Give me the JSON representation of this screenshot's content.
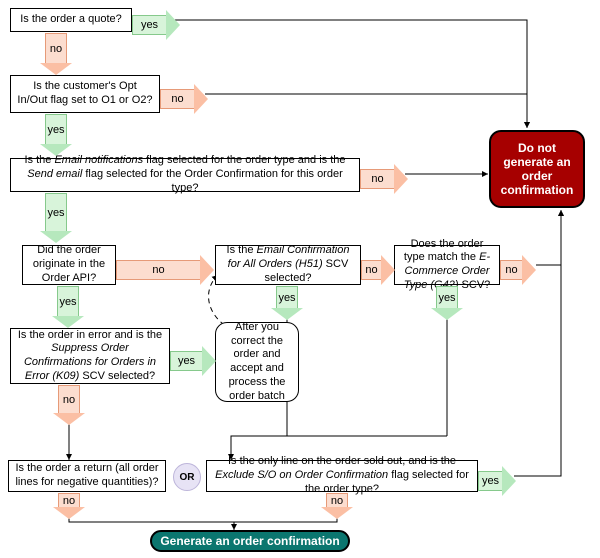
{
  "labels": {
    "yes": "yes",
    "no": "no",
    "or": "OR"
  },
  "nodes": {
    "q_quote": "Is the order a quote?",
    "q_optin": "Is the customer's Opt In/Out flag set to O1 or O2?",
    "q_emailflags_html": "Is the <em>Email notifications</em> flag selected for the order type and is the <em>Send email</em> flag selected for the Order Confirmation for this order type?",
    "q_api": "Did the order originate in the Order API?",
    "q_h51_html": "Is the <em>Email Confirmation for All Orders (H51)</em> SCV selected?",
    "q_g42_html": "Does the order type match the <em>E-Commerce Order Type (G42)</em> SCV?",
    "q_suppress_html": "Is the order in error and is the <em>Suppress Order Confirmations for Orders in Error (K09)</em> SCV selected?",
    "n_afterfix": "After you correct the order and accept and process the order batch",
    "q_return": "Is the order a return (all order lines for negative quantities)?",
    "q_soldout_html": "Is the only line on the order sold out, and is the <em>Exclude S/O on Order Confirmation</em> flag selected for the order type?",
    "t_stop": "Do not generate an order confirmation",
    "t_go": "Generate an order confirmation"
  }
}
